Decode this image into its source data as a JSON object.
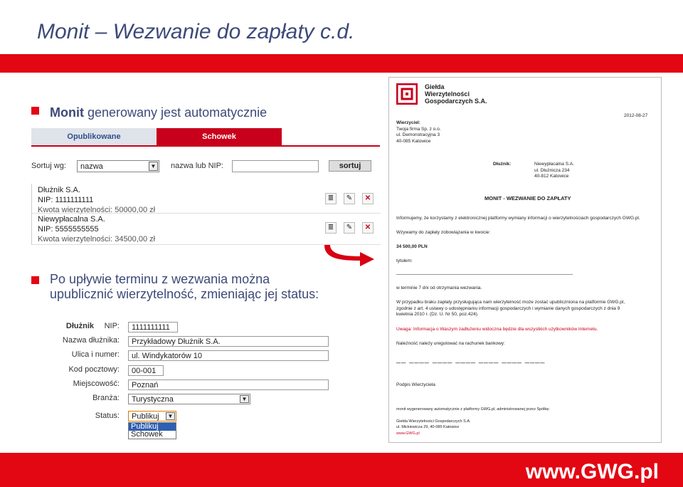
{
  "slide": {
    "title": "Monit – Wezwanie do zapłaty c.d.",
    "footer_url": "www.GWG.pl",
    "bullet1_bold": "Monit",
    "bullet1_rest": " generowany jest automatycznie",
    "bullet2_line1": "Po upływie terminu z wezwania można",
    "bullet2_line2": "upublicznić wierzytelność, zmieniając jej status:"
  },
  "list_panel": {
    "tabs": [
      "Opublikowane",
      "Schowek"
    ],
    "sort_label": "Sortuj wg:",
    "sort_value": "nazwa",
    "nip_label": "nazwa lub NIP:",
    "sort_button": "sortuj",
    "items": [
      {
        "name": "Dłużnik S.A.",
        "nip": "NIP: 1111111111",
        "amount": "Kwota wierzytelności: 50000,00 zł"
      },
      {
        "name": "Niewypłacalna S.A.",
        "nip": "NIP: 5555555555",
        "amount": "Kwota wierzytelności: 34500,00 zł"
      }
    ]
  },
  "form": {
    "heading": "Dłużnik",
    "nip_label": "NIP:",
    "nip_value": "1111111111",
    "name_label": "Nazwa dłużnika:",
    "name_value": "Przykładowy Dłużnik S.A.",
    "street_label": "Ulica i numer:",
    "street_value": "ul. Windykatorów 10",
    "zip_label": "Kod pocztowy:",
    "zip_value": "00-001",
    "city_label": "Miejscowość:",
    "city_value": "Poznań",
    "industry_label": "Branża:",
    "industry_value": "Turystyczna",
    "status_label": "Status:",
    "status_value": "Publikuj",
    "status_options": [
      "Publikuj",
      "Schowek"
    ]
  },
  "document": {
    "logo_line1": "Giełda",
    "logo_line2": "Wierzytelności",
    "logo_line3": "Gospodarczych S.A.",
    "date": "2012-08-27",
    "creditor_label": "Wierzyciel:",
    "creditor_1": "Twoja firma Sp. z o.o.",
    "creditor_2": "ul. Demonstracyjna 3",
    "creditor_3": "40-085 Katowice",
    "debtor_label": "Dłużnik:",
    "debtor_1": "Niewypłacalna S.A.",
    "debtor_2": "ul. Dłużnicza 234",
    "debtor_3": "40-812 Katowice",
    "heading": "MONIT - WEZWANIE DO ZAPŁATY",
    "p1": "Informujemy, że korzystamy z elektronicznej platformy wymiany informacji o wierzytelnościach gospodarczych GWG.pl.",
    "p2": "Wzywamy do zapłaty zobowiązania w kwocie:",
    "amount": "34 500,00 PLN",
    "title_label": "tytułem:",
    "p3": "w terminie 7 dni od otrzymania wezwania.",
    "p4a": "W przypadku braku zapłaty przysługująca nam wierzytelność może zostać upubliczniona na platformie GWG.pl,",
    "p4b": "zgodnie z art. 4 ustawy o udostępnianiu informacji gospodarczych i wymianie danych gospodarczych z dnia 9",
    "p4c": "kwietnia 2010 r. (Dz. U. Nr 50, poz.424).",
    "warning": "Uwaga: Informacja o Waszym zadłużeniu widoczna będzie dla wszystkich użytkowników Internetu.",
    "p5": "Należność należy uregulować na rachunek bankowy:",
    "account_dashes": "__ ____ ____ ____ ____ ____ ____",
    "signature": "Podpis Wierzyciela",
    "footer1": "monit wygenerowany automatycznie z platformy GWG.pl, administrowanej przez Spółkę:",
    "footer2": "Giełda Wierzytelności Gospodarczych S.A.",
    "footer3": "ul. Mickiewicza 29, 40-085 Katowice",
    "footer4": "www.GWG.pl"
  },
  "colors": {
    "brand_red": "#e30613",
    "title_blue": "#3c4a78"
  }
}
